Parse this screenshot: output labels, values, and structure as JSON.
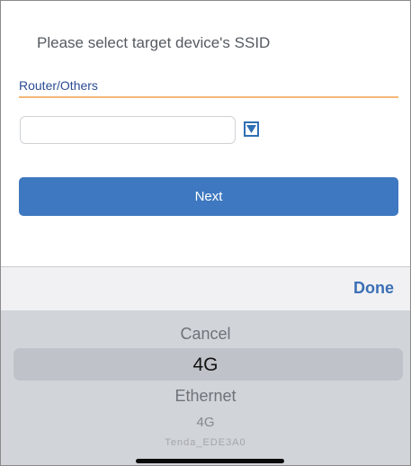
{
  "header": {
    "title": "Please select target device's SSID"
  },
  "section": {
    "label": "Router/Others"
  },
  "ssid_field": {
    "value": "",
    "placeholder": ""
  },
  "dropdown": {
    "icon": "triangle-down-icon"
  },
  "actions": {
    "next_label": "Next"
  },
  "picker": {
    "done_label": "Done",
    "options": [
      "Cancel",
      "4G",
      "Ethernet",
      "4G",
      "Tenda_EDE3A0"
    ],
    "selected_index": 1
  },
  "colors": {
    "accent_blue": "#3e78c0",
    "section_text": "#2b4c93",
    "section_underline": "#f2b878",
    "done_text": "#3b6fb6",
    "picker_background": "#d1d4d9"
  }
}
